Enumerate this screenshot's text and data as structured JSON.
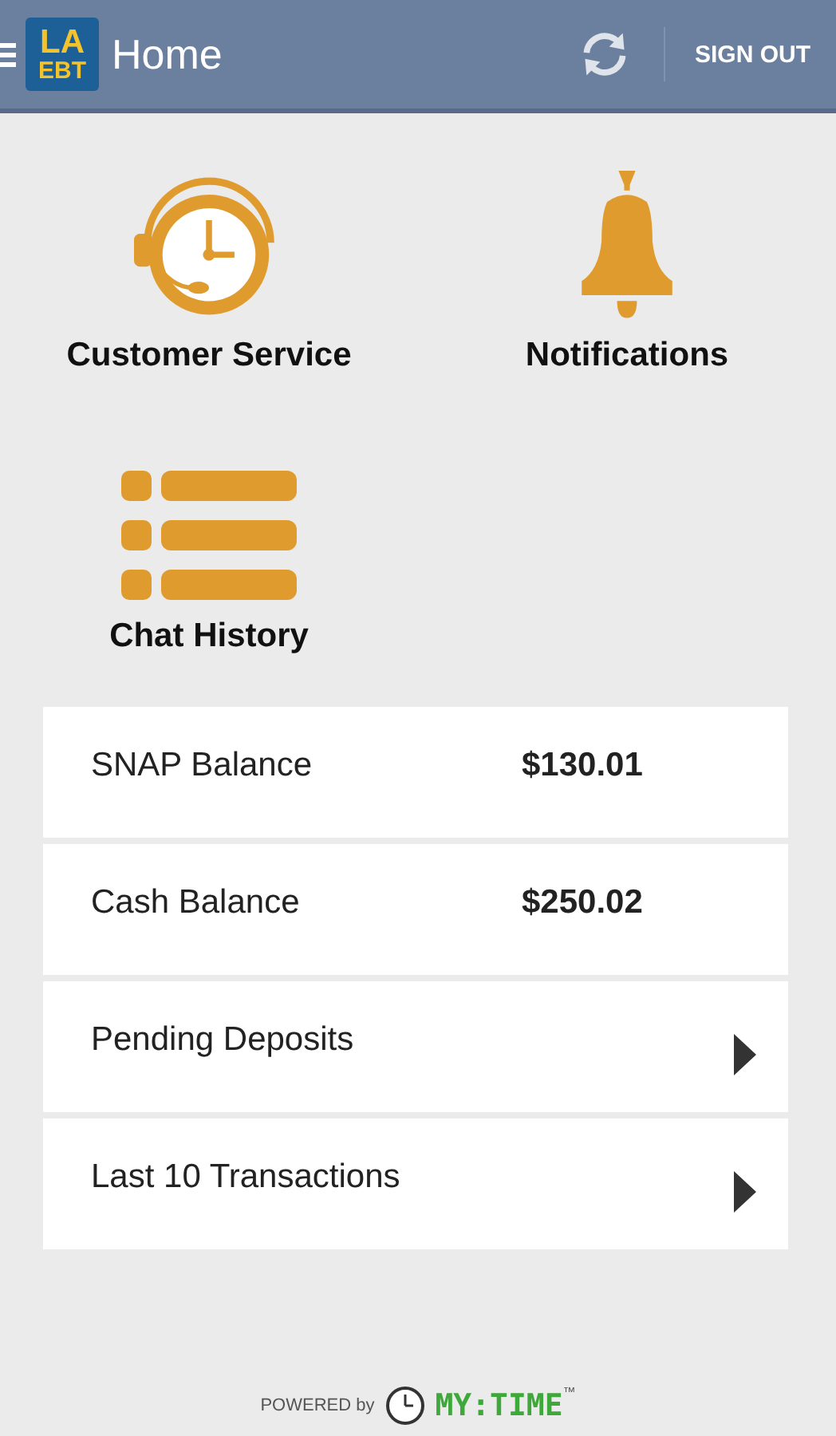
{
  "header": {
    "logo_top": "LA",
    "logo_bottom": "EBT",
    "title": "Home",
    "sign_out": "SIGN OUT"
  },
  "shortcuts": [
    {
      "label": "Customer Service",
      "kind": "support"
    },
    {
      "label": "Notifications",
      "kind": "bell"
    },
    {
      "label": "Chat History",
      "kind": "list"
    }
  ],
  "rows": [
    {
      "label": "SNAP Balance",
      "kind": "balance",
      "value": "$130.01"
    },
    {
      "label": "Cash Balance",
      "kind": "balance",
      "value": "$250.02"
    },
    {
      "label": "Pending Deposits",
      "kind": "link"
    },
    {
      "label": "Last 10 Transactions",
      "kind": "link"
    }
  ],
  "footer": {
    "powered": "POWERED by",
    "brand": "MY:TIME",
    "tm": "™"
  }
}
